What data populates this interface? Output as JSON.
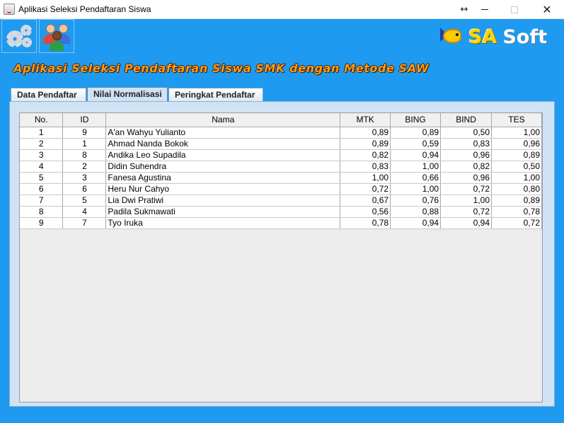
{
  "window": {
    "title": "Aplikasi Seleksi Pendaftaran Siswa",
    "controls": {
      "resize": "↔",
      "close": "✕"
    }
  },
  "toolbar": {
    "items": [
      {
        "icon": "gear-icon"
      },
      {
        "icon": "users-icon"
      }
    ]
  },
  "logo": {
    "part1": "SA",
    "part2": "Soft"
  },
  "header": {
    "title": "Aplikasi Seleksi Pendaftaran Siswa SMK dengan Metode SAW"
  },
  "tabs": [
    {
      "label": "Data Pendaftar",
      "selected": false
    },
    {
      "label": "Nilai Normalisasi",
      "selected": true
    },
    {
      "label": "Peringkat Pendaftar",
      "selected": false
    }
  ],
  "table": {
    "columns": [
      "No.",
      "ID",
      "Nama",
      "MTK",
      "BING",
      "BIND",
      "TES"
    ],
    "rows": [
      [
        "1",
        "9",
        "A'an Wahyu Yulianto",
        "0,89",
        "0,89",
        "0,50",
        "1,00"
      ],
      [
        "2",
        "1",
        "Ahmad Nanda Bokok",
        "0,89",
        "0,59",
        "0,83",
        "0,96"
      ],
      [
        "3",
        "8",
        "Andika Leo Supadila",
        "0,82",
        "0,94",
        "0,96",
        "0,89"
      ],
      [
        "4",
        "2",
        "Didin Suhendra",
        "0,83",
        "1,00",
        "0,82",
        "0,50"
      ],
      [
        "5",
        "3",
        "Fanesa Agustina",
        "1,00",
        "0,66",
        "0,96",
        "1,00"
      ],
      [
        "6",
        "6",
        "Heru Nur Cahyo",
        "0,72",
        "1,00",
        "0,72",
        "0,80"
      ],
      [
        "7",
        "5",
        "Lia Dwi Pratiwi",
        "0,67",
        "0,76",
        "1,00",
        "0,89"
      ],
      [
        "8",
        "4",
        "Padila Sukmawati",
        "0,56",
        "0,88",
        "0,72",
        "0,78"
      ],
      [
        "9",
        "7",
        "Tyo Iruka",
        "0,78",
        "0,94",
        "0,94",
        "0,72"
      ]
    ]
  },
  "colors": {
    "main_background": "#1e9bf0",
    "title_text": "#ff9a1a",
    "panel_background": "#cfe3f5"
  }
}
